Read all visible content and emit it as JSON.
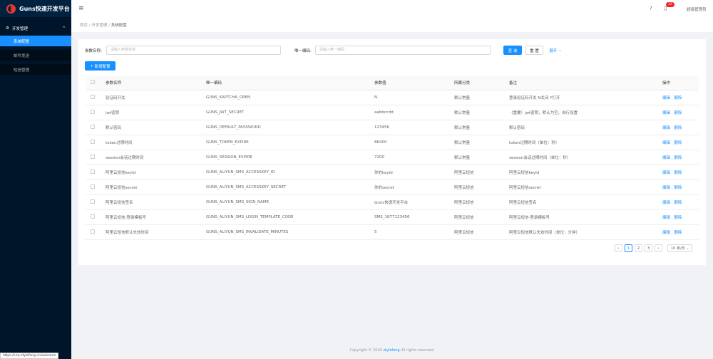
{
  "app": {
    "title": "Guns快速开发平台"
  },
  "sidebar": {
    "group": "开发管理",
    "items": [
      {
        "label": "系统配置",
        "active": true
      },
      {
        "label": "邮件发送"
      },
      {
        "label": "短信管理"
      }
    ]
  },
  "header": {
    "notification_count": "12",
    "user": "超级管理员",
    "icons": [
      "menu-fold-icon",
      "question-icon",
      "bell-icon"
    ]
  },
  "breadcrumb": [
    "首页",
    "开发管理",
    "系统配置"
  ],
  "search": {
    "name_label": "参数名称:",
    "name_placeholder": "请输入参数名称",
    "code_label": "唯一编码:",
    "code_placeholder": "请输入唯一编码",
    "query": "查 询",
    "reset": "重 置",
    "expand": "展开"
  },
  "add_button": "新增配置",
  "table": {
    "columns": [
      "参数名称",
      "唯一编码",
      "参数值",
      "所属分类",
      "备注",
      "操作"
    ],
    "edit": "编辑",
    "delete": "删除",
    "rows": [
      [
        "验证码开关",
        "GUNS_KAPTCHA_OPEN",
        "N",
        "默认常量",
        "登录验证码开关 N关闭 Y打开"
      ],
      [
        "jwt密钥",
        "GUNS_JWT_SECRET",
        "aabbccdd",
        "默认常量",
        "（重要）jwt密钥，默认为空，自行设置"
      ],
      [
        "默认密码",
        "GUNS_DEFAULT_PASSWORD",
        "123456",
        "默认常量",
        "默认密码"
      ],
      [
        "token过期时间",
        "GUNS_TOKEN_EXPIRE",
        "86400",
        "默认常量",
        "token过期时间（单位：秒）"
      ],
      [
        "session会话过期时间",
        "GUNS_SESSION_EXPIRE",
        "7200",
        "默认常量",
        "session会话过期时间（单位：秒）"
      ],
      [
        "阿里云短信keyId",
        "GUNS_ALIYUN_SMS_ACCESSKEY_ID",
        "你的keyId",
        "阿里云短信",
        "阿里云短信keyId"
      ],
      [
        "阿里云短信secret",
        "GUNS_ALIYUN_SMS_ACCESSKEY_SECRET",
        "你的secret",
        "阿里云短信",
        "阿里云短信secret"
      ],
      [
        "阿里云短信签名",
        "GUNS_ALIYUN_SMS_SIGN_NAME",
        "Guns快速开发平台",
        "阿里云短信",
        "阿里云短信签名"
      ],
      [
        "阿里云短信-登录模板号",
        "GUNS_ALIYUN_SMS_LOGIN_TEMPLATE_CODE",
        "SMS_1877123456",
        "阿里云短信",
        "阿里云短信-登录模板号"
      ],
      [
        "阿里云短信默认失效时间",
        "GUNS_ALIYUN_SMS_INVALIDATE_MINUTES",
        "5",
        "阿里云短信",
        "阿里云短信默认失效时间（单位：分钟）"
      ]
    ]
  },
  "pagination": {
    "pages": [
      "1",
      "2",
      "3"
    ],
    "current": "1",
    "page_size": "10 条/页"
  },
  "footer": {
    "prefix": "Copyright © 2020 ",
    "link": "stylefeng",
    "suffix": " All rights reserved."
  },
  "status_url": "https://urp.stylefeng.cn/welcome",
  "colors": {
    "primary": "#1890ff",
    "sidebar": "#001529",
    "badge": "#f5222d"
  }
}
